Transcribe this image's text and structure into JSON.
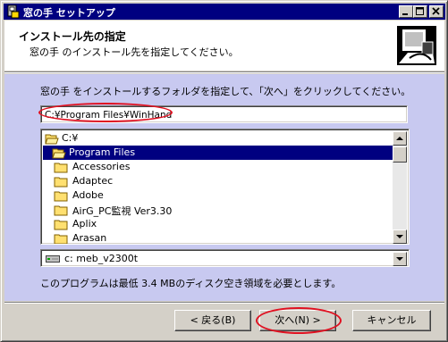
{
  "window": {
    "title": "窓の手 セットアップ"
  },
  "header": {
    "heading": "インストール先の指定",
    "subheading": "窓の手 のインストール先を指定してください。"
  },
  "body": {
    "instruction": "窓の手 をインストールするフォルダを指定して、「次へ」をクリックしてください。",
    "path_value": "C:¥Program Files¥WinHand",
    "folders": [
      {
        "label": "C:¥",
        "selected": false,
        "open": true
      },
      {
        "label": "Program Files",
        "selected": true,
        "open": true
      },
      {
        "label": "Accessories",
        "selected": false
      },
      {
        "label": "Adaptec",
        "selected": false
      },
      {
        "label": "Adobe",
        "selected": false
      },
      {
        "label": "AirG_PC監視 Ver3.30",
        "selected": false
      },
      {
        "label": "Aplix",
        "selected": false
      },
      {
        "label": "Arasan",
        "selected": false
      }
    ],
    "drive": "c: meb_v2300t",
    "space_note": "このプログラムは最低 3.4 MBのディスク空き領域を必要とします。"
  },
  "buttons": {
    "back": "< 戻る(B)",
    "next": "次へ(N) >",
    "cancel": "キャンセル"
  },
  "colors": {
    "titlebar": "#000080",
    "body_bg": "#c8c9f0",
    "annotation": "#e01020"
  }
}
